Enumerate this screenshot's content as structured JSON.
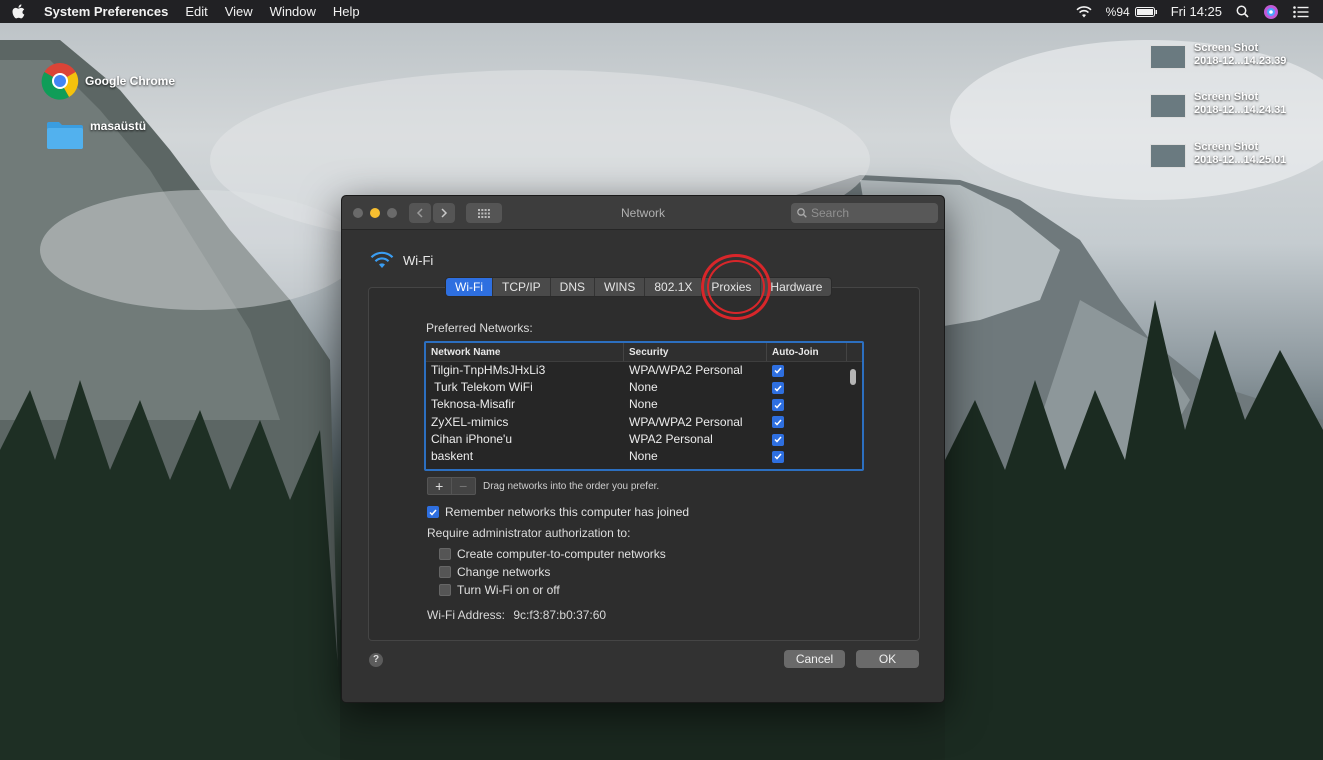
{
  "menubar": {
    "apple_icon": "apple-logo-icon",
    "items": [
      "System Preferences",
      "Edit",
      "View",
      "Window",
      "Help"
    ],
    "battery": "%94",
    "clock": "Fri 14:25"
  },
  "desktop": {
    "icons": [
      {
        "label": "Google Chrome",
        "icon": "chrome-icon"
      },
      {
        "label": "masaüstü",
        "icon": "folder-icon"
      }
    ],
    "screenshots": [
      {
        "line1": "Screen Shot",
        "line2": "2018-12...14.23.39"
      },
      {
        "line1": "Screen Shot",
        "line2": "2018-12...14.24.31"
      },
      {
        "line1": "Screen Shot",
        "line2": "2018-12...14.25.01"
      }
    ]
  },
  "window": {
    "title": "Network",
    "search_placeholder": "Search",
    "interface_name": "Wi-Fi",
    "tabs": [
      "Wi-Fi",
      "TCP/IP",
      "DNS",
      "WINS",
      "802.1X",
      "Proxies",
      "Hardware"
    ],
    "active_tab": "Wi-Fi",
    "preferred_label": "Preferred Networks:",
    "columns": [
      "Network Name",
      "Security",
      "Auto-Join"
    ],
    "networks": [
      {
        "name": "Tilgin-TnpHMsJHxLi3",
        "security": "WPA/WPA2 Personal",
        "auto_join": true
      },
      {
        "name": " Turk Telekom WiFi",
        "security": "None",
        "auto_join": true
      },
      {
        "name": "Teknosa-Misafir",
        "security": "None",
        "auto_join": true
      },
      {
        "name": "ZyXEL-mimics",
        "security": "WPA/WPA2 Personal",
        "auto_join": true
      },
      {
        "name": "Cihan iPhone'u",
        "security": "WPA2 Personal",
        "auto_join": true
      },
      {
        "name": "baskent",
        "security": "None",
        "auto_join": true
      }
    ],
    "add_label": "+",
    "remove_label": "−",
    "drag_hint": "Drag networks into the order you prefer.",
    "remember_label": "Remember networks this computer has joined",
    "remember_checked": true,
    "require_label": "Require administrator authorization to:",
    "admin_options": [
      {
        "label": "Create computer-to-computer networks",
        "checked": false
      },
      {
        "label": "Change networks",
        "checked": false
      },
      {
        "label": "Turn Wi-Fi on or off",
        "checked": false
      }
    ],
    "address_label": "Wi-Fi Address:",
    "address_value": "9c:f3:87:b0:37:60",
    "help_label": "?",
    "cancel_label": "Cancel",
    "ok_label": "OK"
  },
  "colors": {
    "accent": "#2e6fe0",
    "highlight_circle": "#d8262a",
    "minimize_light": "#f6be30"
  }
}
